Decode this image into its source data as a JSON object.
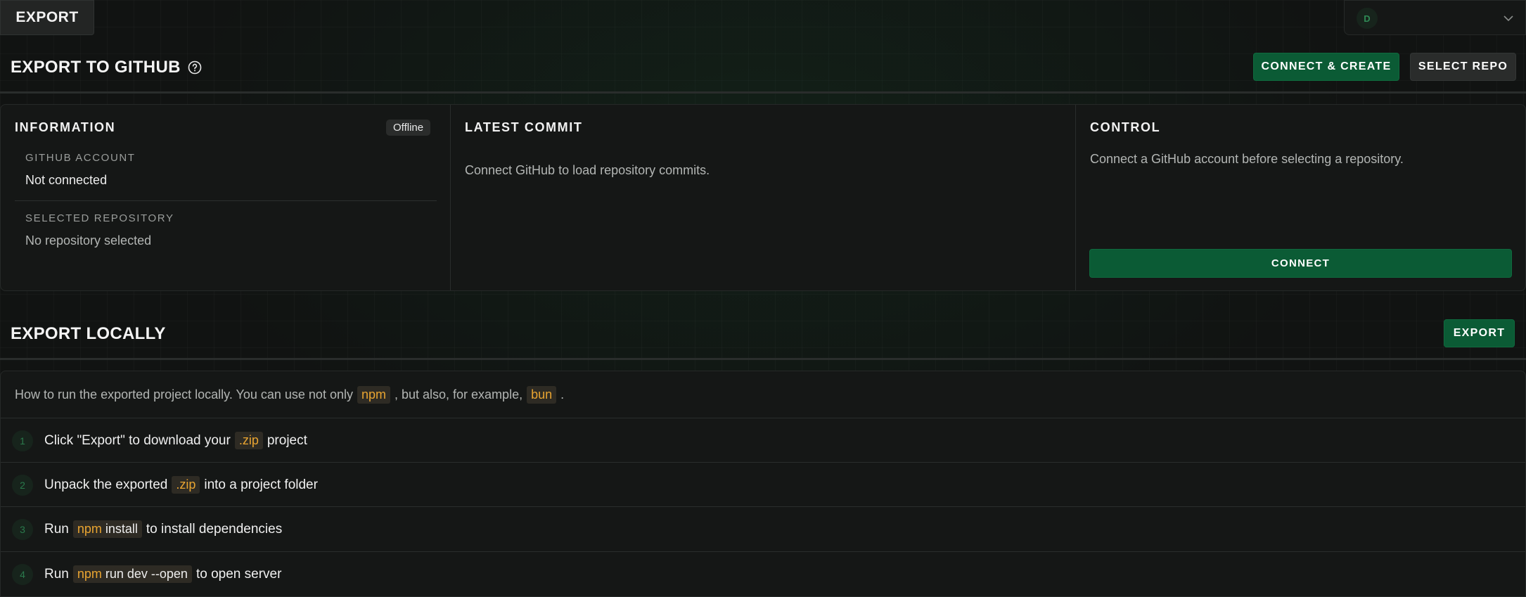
{
  "header": {
    "tab_label": "EXPORT",
    "account_initial": "D"
  },
  "github": {
    "title": "EXPORT TO GITHUB",
    "connect_create_label": "CONNECT & CREATE",
    "select_repo_label": "SELECT REPO"
  },
  "info": {
    "title": "INFORMATION",
    "status": "Offline",
    "account_label": "GITHUB ACCOUNT",
    "account_value": "Not connected",
    "repo_label": "SELECTED REPOSITORY",
    "repo_value": "No repository selected"
  },
  "commit": {
    "title": "LATEST COMMIT",
    "message": "Connect GitHub to load repository commits."
  },
  "control": {
    "title": "CONTROL",
    "message": "Connect a GitHub account before selecting a repository.",
    "connect_label": "CONNECT"
  },
  "local": {
    "title": "EXPORT LOCALLY",
    "export_label": "EXPORT",
    "intro_a": "How to run the exported project locally. You can use not only",
    "intro_npm": "npm",
    "intro_b": ", but also, for example,",
    "intro_bun": "bun",
    "intro_c": ".",
    "steps": [
      {
        "num": "1",
        "pre": "Click \"Export\" to download your",
        "code_kw": ".zip",
        "code_rest": "",
        "post": "project"
      },
      {
        "num": "2",
        "pre": "Unpack the exported",
        "code_kw": ".zip",
        "code_rest": "",
        "post": "into a project folder"
      },
      {
        "num": "3",
        "pre": "Run",
        "code_kw": "npm",
        "code_rest": " install",
        "post": "to install dependencies"
      },
      {
        "num": "4",
        "pre": "Run",
        "code_kw": "npm",
        "code_rest": " run dev --open",
        "post": "to open server"
      }
    ]
  },
  "colors": {
    "accent_green": "#0b5b35",
    "code_highlight": "#e8a431"
  }
}
